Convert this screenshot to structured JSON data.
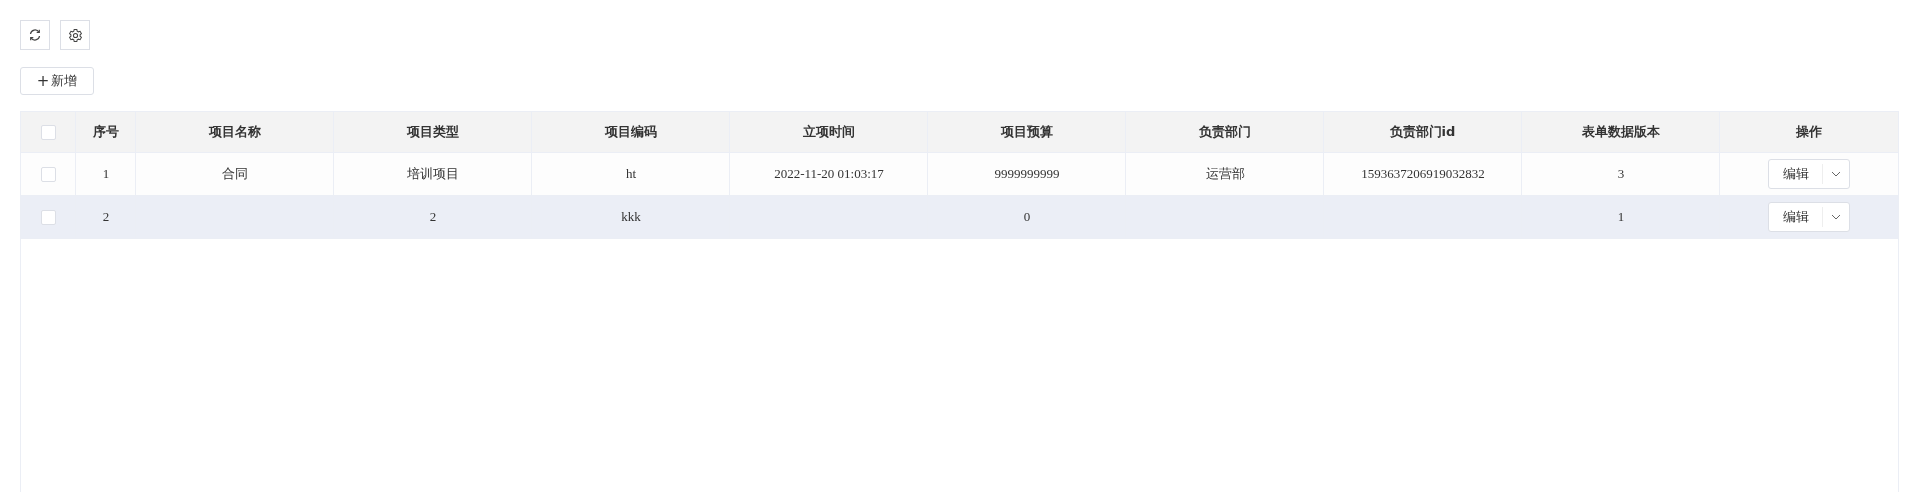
{
  "toolbar": {
    "add_button": {
      "icon": "+",
      "label": "新增"
    }
  },
  "table": {
    "columns": [
      "序号",
      "项目名称",
      "项目类型",
      "项目编码",
      "立项时间",
      "项目预算",
      "负责部门",
      "负责部门id",
      "表单数据版本",
      "操作"
    ],
    "header_checked": false,
    "rows": [
      {
        "checked": false,
        "hovered": false,
        "cells": [
          "1",
          "合同",
          "培训项目",
          "ht",
          "2022-11-20 01:03:17",
          "9999999999",
          "运营部",
          "1593637206919032832",
          "3"
        ],
        "action": "编辑"
      },
      {
        "checked": false,
        "hovered": true,
        "cells": [
          "2",
          null,
          "2",
          "kkk",
          null,
          "0",
          null,
          null,
          "1"
        ],
        "action": "编辑"
      }
    ]
  }
}
